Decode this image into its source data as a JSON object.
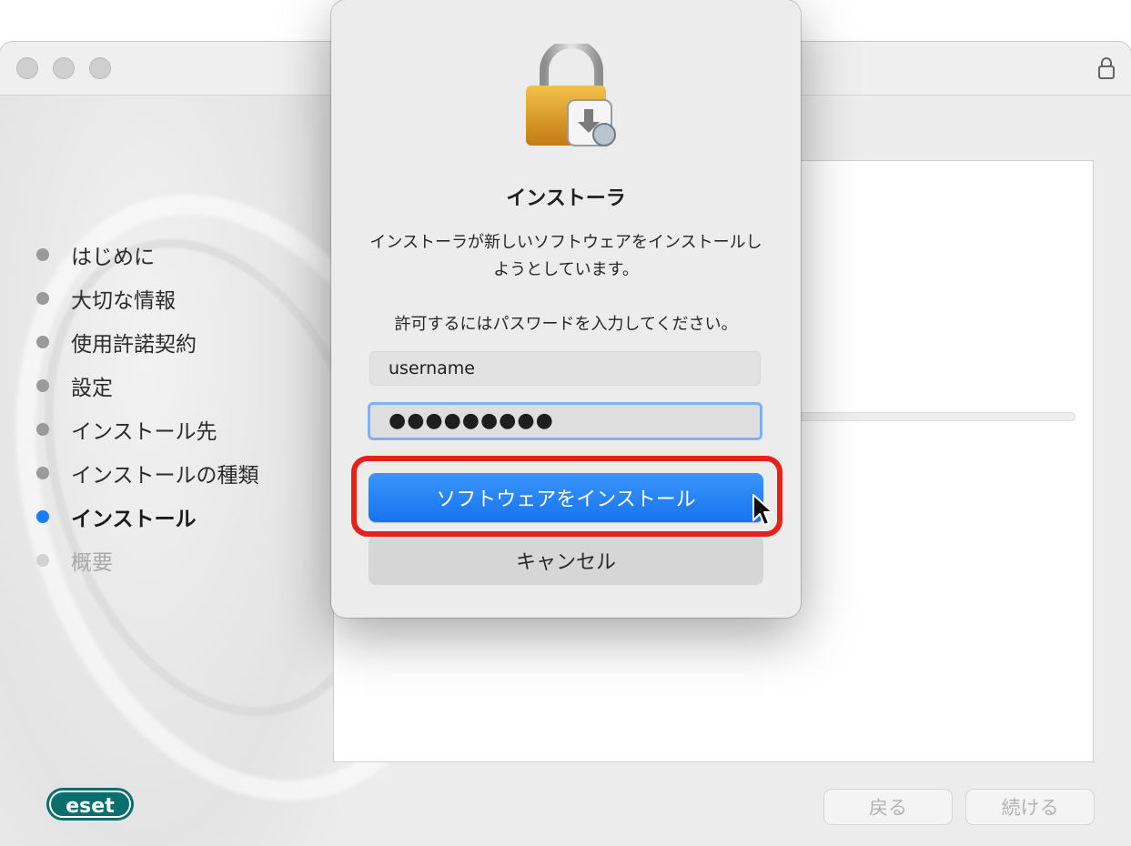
{
  "sidebar": {
    "steps": [
      {
        "label": "はじめに"
      },
      {
        "label": "大切な情報"
      },
      {
        "label": "使用許諾契約"
      },
      {
        "label": "設定"
      },
      {
        "label": "インストール先"
      },
      {
        "label": "インストールの種類"
      },
      {
        "label": "インストール"
      },
      {
        "label": "概要"
      }
    ],
    "current_index": 6
  },
  "footer": {
    "back_label": "戻る",
    "continue_label": "続ける",
    "logo_text": "eset"
  },
  "dialog": {
    "title": "インストーラ",
    "message": "インストーラが新しいソフトウェアをインストールしようとしています。",
    "prompt": "許可するにはパスワードを入力してください。",
    "username": "username",
    "password_masked": "●●●●●●●●●",
    "install_label": "ソフトウェアをインストール",
    "cancel_label": "キャンセル"
  },
  "colors": {
    "accent": "#1a7cf2",
    "highlight": "#e8201a",
    "brand": "#0a6e6e"
  }
}
